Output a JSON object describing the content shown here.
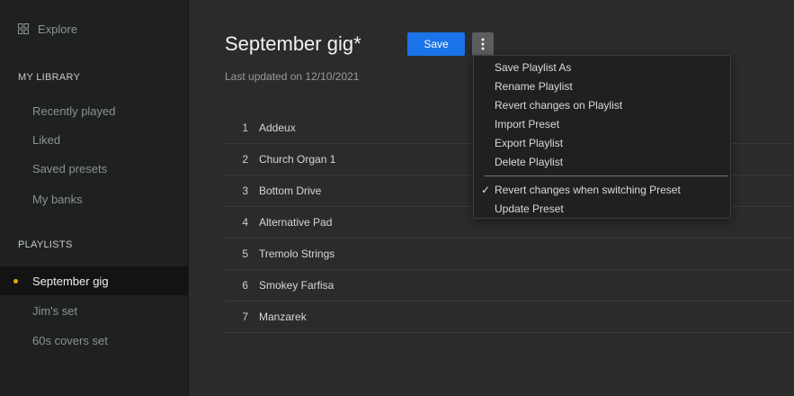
{
  "sidebar": {
    "explore": {
      "icon": "grid-icon",
      "label": "Explore"
    },
    "library_header": "MY LIBRARY",
    "library_items": [
      {
        "label": "Recently played"
      },
      {
        "label": "Liked"
      },
      {
        "label": "Saved presets"
      },
      {
        "label": "My banks"
      }
    ],
    "playlists_header": "PLAYLISTS",
    "playlists": [
      {
        "label": "September gig",
        "active": true
      },
      {
        "label": "Jim's set",
        "active": false
      },
      {
        "label": "60s covers set",
        "active": false
      }
    ],
    "active_indicator_color": "#f0a500"
  },
  "main": {
    "title": "September gig*",
    "save_label": "Save",
    "more_icon": "more-vertical-icon",
    "subtitle": "Last updated on 12/10/2021",
    "presets": [
      {
        "num": "1",
        "name": "Addeux"
      },
      {
        "num": "2",
        "name": "Church Organ 1"
      },
      {
        "num": "3",
        "name": "Bottom Drive"
      },
      {
        "num": "4",
        "name": "Alternative Pad"
      },
      {
        "num": "5",
        "name": "Tremolo Strings"
      },
      {
        "num": "6",
        "name": "Smokey Farfisa"
      },
      {
        "num": "7",
        "name": "Manzarek"
      }
    ]
  },
  "menu": {
    "items": [
      {
        "label": "Save Playlist As"
      },
      {
        "label": "Rename Playlist"
      },
      {
        "label": "Revert changes on Playlist"
      },
      {
        "label": "Import Preset"
      },
      {
        "label": "Export Playlist"
      },
      {
        "label": "Delete Playlist"
      }
    ],
    "options": [
      {
        "label": "Revert changes when switching Preset",
        "checked": true,
        "check": "✓"
      },
      {
        "label": "Update Preset",
        "checked": false,
        "check": ""
      }
    ]
  },
  "colors": {
    "accent": "#1a73e8",
    "active_dot": "#f0a500",
    "background": "#2b2b2b",
    "sidebar": "#1e2120"
  }
}
